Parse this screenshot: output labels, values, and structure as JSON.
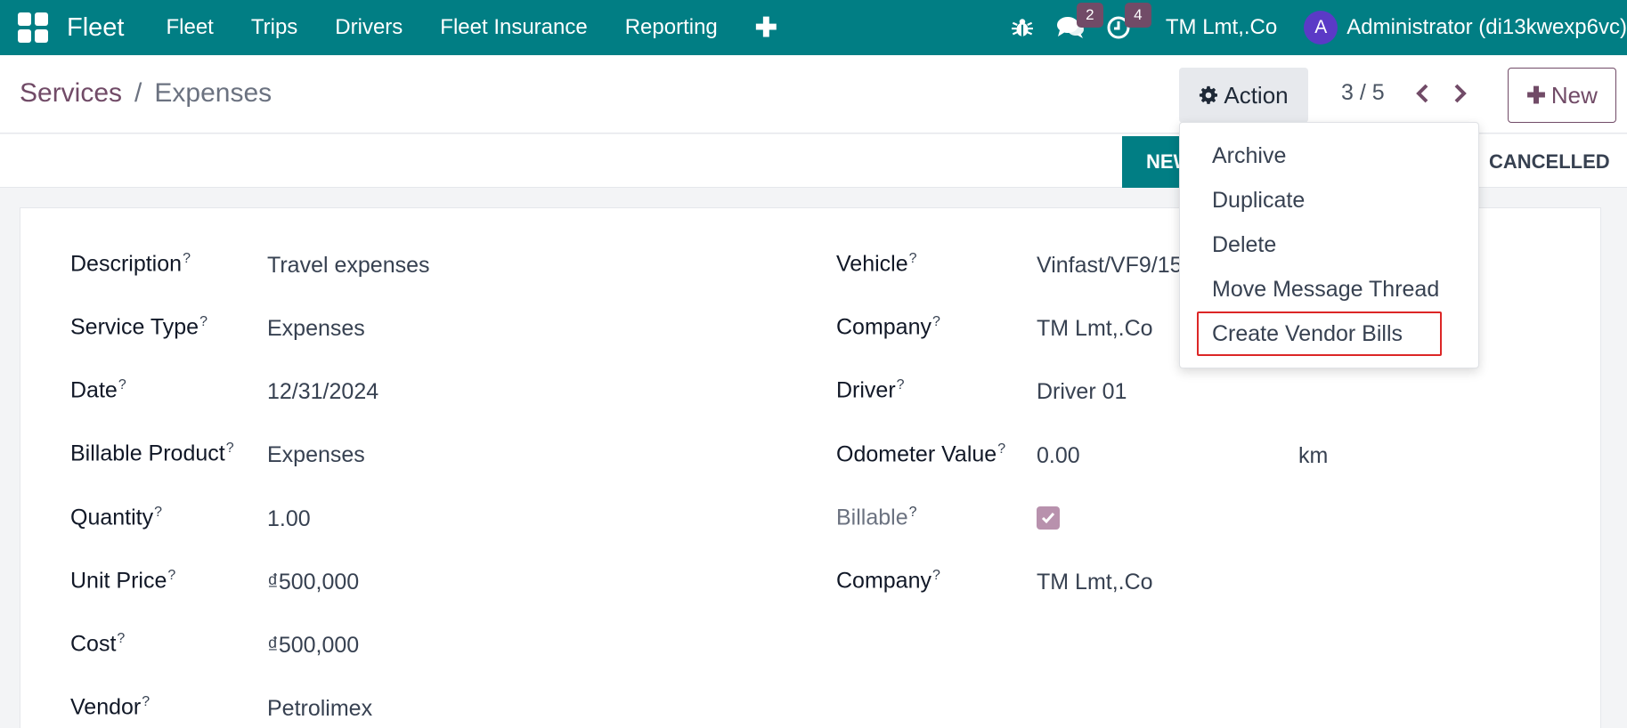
{
  "navbar": {
    "app_name": "Fleet",
    "menu": [
      "Fleet",
      "Trips",
      "Drivers",
      "Fleet Insurance",
      "Reporting"
    ],
    "plus_icon": "plus-icon",
    "messages_badge": "2",
    "activities_badge": "4",
    "company": "TM Lmt,.Co",
    "avatar_letter": "A",
    "user": "Administrator (di13kwexp6vc)",
    "accent_color": "#017e84"
  },
  "breadcrumb": {
    "parent": "Services",
    "separator": "/",
    "current": "Expenses"
  },
  "toolbar": {
    "action_label": "Action",
    "pager": "3 / 5",
    "new_label": "New"
  },
  "statusbar": {
    "new_stage": "NEW",
    "cancelled_stage": "CANCELLED"
  },
  "action_menu": {
    "items": [
      "Archive",
      "Duplicate",
      "Delete",
      "Move Message Thread",
      "Create Vendor Bills"
    ],
    "highlighted": "Create Vendor Bills",
    "highlight_color": "#dc2626"
  },
  "form": {
    "help_mark": "?",
    "left": [
      {
        "label": "Description",
        "value": "Travel expenses"
      },
      {
        "label": "Service Type",
        "value": "Expenses"
      },
      {
        "label": "Date",
        "value": "12/31/2024"
      },
      {
        "label": "Billable Product",
        "value": "Expenses"
      },
      {
        "label": "Quantity",
        "value": "1.00"
      },
      {
        "label": "Unit Price",
        "value": "₫500,000"
      },
      {
        "label": "Cost",
        "value": "₫500,000"
      },
      {
        "label": "Vendor",
        "value": "Petrolimex"
      }
    ],
    "right": [
      {
        "label": "Vehicle",
        "value": "Vinfast/VF9/15"
      },
      {
        "label": "Company",
        "value": "TM Lmt,.Co"
      },
      {
        "label": "Driver",
        "value": "Driver 01"
      },
      {
        "label": "Odometer Value",
        "value": "0.00",
        "unit": "km"
      },
      {
        "label": "Billable",
        "checked": true
      },
      {
        "label": "Company",
        "value": "TM Lmt,.Co"
      }
    ]
  }
}
